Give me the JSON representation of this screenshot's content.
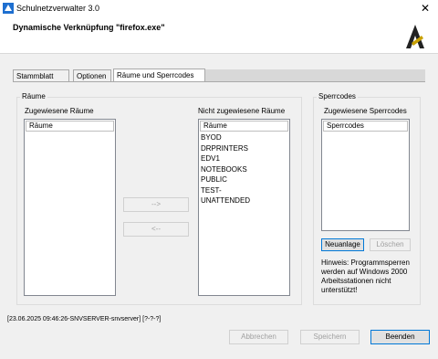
{
  "window": {
    "title": "Schulnetzverwalter 3.0"
  },
  "header": {
    "title": "Dynamische Verknüpfung \"firefox.exe\""
  },
  "tabs": [
    {
      "label": "Stammblatt"
    },
    {
      "label": "Optionen"
    },
    {
      "label": "Räume und Sperrcodes"
    }
  ],
  "rooms": {
    "group_label": "Räume",
    "assigned_label": "Zugewiesene Räume",
    "assigned_header": "Räume",
    "assigned_items": [],
    "unassigned_label": "Nicht zugewiesene Räume",
    "unassigned_header": "Räume",
    "unassigned_items": [
      "BYOD",
      "DRPRINTERS",
      "EDV1",
      "NOTEBOOKS",
      "PUBLIC",
      "TEST-",
      "UNATTENDED"
    ],
    "move_right_label": "-->",
    "move_left_label": "<--"
  },
  "lockcodes": {
    "group_label": "Sperrcodes",
    "assigned_label": "Zugewiesene Sperrcodes",
    "header": "Sperrcodes",
    "new_label": "Neuanlage",
    "delete_label": "Löschen",
    "hint": "Hinweis: Programmsperren werden auf Windows 2000 Arbeitsstationen nicht unterstützt!"
  },
  "status": {
    "text": "[23.06.2025 09:46:26-SNVSERVER-snvserver] [?-?-?]"
  },
  "footer": {
    "cancel_label": "Abbrechen",
    "save_label": "Speichern",
    "exit_label": "Beenden"
  }
}
